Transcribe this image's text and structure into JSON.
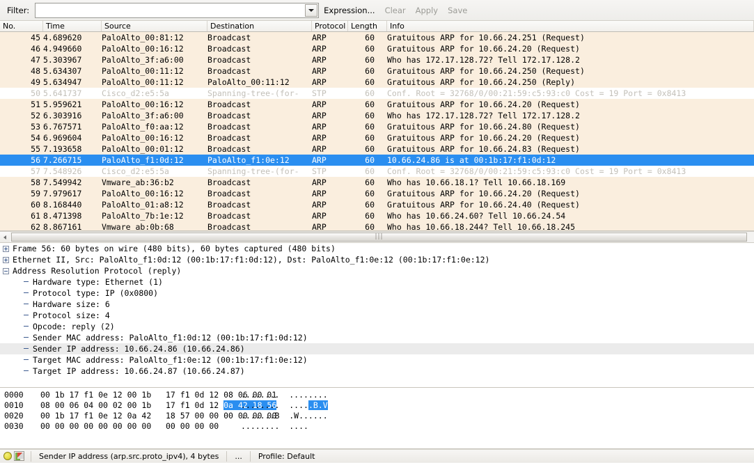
{
  "app": {
    "title": "Wireshark"
  },
  "filter_bar": {
    "label": "Filter:",
    "value": "",
    "placeholder": "",
    "dropdown_icon": "chevron-down-icon",
    "expression_label": "Expression...",
    "clear_label": "Clear",
    "apply_label": "Apply",
    "save_label": "Save",
    "accent_selected": "#2a8ef0",
    "row_bg": "#faeede",
    "stp_row_bg": "#ffffff",
    "stp_text": "#c0bdb6"
  },
  "packet_list": {
    "columns": [
      "No.",
      "Time",
      "Source",
      "Destination",
      "Protocol",
      "Length",
      "Info"
    ],
    "rows": [
      {
        "no": "45",
        "time": "4.689620",
        "source": "PaloAlto_00:81:12",
        "destination": "Broadcast",
        "protocol": "ARP",
        "length": "60",
        "info": "Gratuitous ARP for 10.66.24.251 (Request)",
        "style": "arp"
      },
      {
        "no": "46",
        "time": "4.949660",
        "source": "PaloAlto_00:16:12",
        "destination": "Broadcast",
        "protocol": "ARP",
        "length": "60",
        "info": "Gratuitous ARP for 10.66.24.20 (Request)",
        "style": "arp"
      },
      {
        "no": "47",
        "time": "5.303967",
        "source": "PaloAlto_3f:a6:00",
        "destination": "Broadcast",
        "protocol": "ARP",
        "length": "60",
        "info": "Who has 172.17.128.72?  Tell 172.17.128.2",
        "style": "arp"
      },
      {
        "no": "48",
        "time": "5.634307",
        "source": "PaloAlto_00:11:12",
        "destination": "Broadcast",
        "protocol": "ARP",
        "length": "60",
        "info": "Gratuitous ARP for 10.66.24.250 (Request)",
        "style": "arp"
      },
      {
        "no": "49",
        "time": "5.634947",
        "source": "PaloAlto_00:11:12",
        "destination": "PaloAlto_00:11:12",
        "protocol": "ARP",
        "length": "60",
        "info": "Gratuitous ARP for 10.66.24.250 (Reply)",
        "style": "arp"
      },
      {
        "no": "50",
        "time": "5.641737",
        "source": "Cisco_d2:e5:5a",
        "destination": "Spanning-tree-(for-",
        "protocol": "STP",
        "length": "60",
        "info": "Conf. Root = 32768/0/00:21:59:c5:93:c0  Cost = 19  Port = 0x8413",
        "style": "stp"
      },
      {
        "no": "51",
        "time": "5.959621",
        "source": "PaloAlto_00:16:12",
        "destination": "Broadcast",
        "protocol": "ARP",
        "length": "60",
        "info": "Gratuitous ARP for 10.66.24.20 (Request)",
        "style": "arp"
      },
      {
        "no": "52",
        "time": "6.303916",
        "source": "PaloAlto_3f:a6:00",
        "destination": "Broadcast",
        "protocol": "ARP",
        "length": "60",
        "info": "Who has 172.17.128.72?  Tell 172.17.128.2",
        "style": "arp"
      },
      {
        "no": "53",
        "time": "6.767571",
        "source": "PaloAlto_f0:aa:12",
        "destination": "Broadcast",
        "protocol": "ARP",
        "length": "60",
        "info": "Gratuitous ARP for 10.66.24.80 (Request)",
        "style": "arp"
      },
      {
        "no": "54",
        "time": "6.969604",
        "source": "PaloAlto_00:16:12",
        "destination": "Broadcast",
        "protocol": "ARP",
        "length": "60",
        "info": "Gratuitous ARP for 10.66.24.20 (Request)",
        "style": "arp"
      },
      {
        "no": "55",
        "time": "7.193658",
        "source": "PaloAlto_00:01:12",
        "destination": "Broadcast",
        "protocol": "ARP",
        "length": "60",
        "info": "Gratuitous ARP for 10.66.24.83 (Request)",
        "style": "arp"
      },
      {
        "no": "56",
        "time": "7.266715",
        "source": "PaloAlto_f1:0d:12",
        "destination": "PaloAlto_f1:0e:12",
        "protocol": "ARP",
        "length": "60",
        "info": "10.66.24.86 is at 00:1b:17:f1:0d:12",
        "style": "selected"
      },
      {
        "no": "57",
        "time": "7.548926",
        "source": "Cisco_d2:e5:5a",
        "destination": "Spanning-tree-(for-",
        "protocol": "STP",
        "length": "60",
        "info": "Conf. Root = 32768/0/00:21:59:c5:93:c0  Cost = 19  Port = 0x8413",
        "style": "stp"
      },
      {
        "no": "58",
        "time": "7.549942",
        "source": "Vmware_ab:36:b2",
        "destination": "Broadcast",
        "protocol": "ARP",
        "length": "60",
        "info": "Who has 10.66.18.1?  Tell 10.66.18.169",
        "style": "arp"
      },
      {
        "no": "59",
        "time": "7.979617",
        "source": "PaloAlto_00:16:12",
        "destination": "Broadcast",
        "protocol": "ARP",
        "length": "60",
        "info": "Gratuitous ARP for 10.66.24.20 (Request)",
        "style": "arp"
      },
      {
        "no": "60",
        "time": "8.168440",
        "source": "PaloAlto_01:a8:12",
        "destination": "Broadcast",
        "protocol": "ARP",
        "length": "60",
        "info": "Gratuitous ARP for 10.66.24.40 (Request)",
        "style": "arp"
      },
      {
        "no": "61",
        "time": "8.471398",
        "source": "PaloAlto_7b:1e:12",
        "destination": "Broadcast",
        "protocol": "ARP",
        "length": "60",
        "info": "Who has 10.66.24.60?  Tell 10.66.24.54",
        "style": "arp"
      },
      {
        "no": "62",
        "time": "8.867161",
        "source": "Vmware_ab:0b:68",
        "destination": "Broadcast",
        "protocol": "ARP",
        "length": "60",
        "info": "Who has 10.66.18.244?  Tell 10.66.18.245",
        "style": "arp"
      }
    ]
  },
  "detail_tree": {
    "nodes": [
      {
        "twisty": "plus",
        "indent": 0,
        "text": "Frame 56: 60 bytes on wire (480 bits), 60 bytes captured (480 bits)",
        "selected": false
      },
      {
        "twisty": "plus",
        "indent": 0,
        "text": "Ethernet II, Src: PaloAlto_f1:0d:12 (00:1b:17:f1:0d:12), Dst: PaloAlto_f1:0e:12 (00:1b:17:f1:0e:12)",
        "selected": false
      },
      {
        "twisty": "minus",
        "indent": 0,
        "text": "Address Resolution Protocol (reply)",
        "selected": false
      },
      {
        "twisty": "none",
        "indent": 1,
        "text": "Hardware type: Ethernet (1)",
        "selected": false
      },
      {
        "twisty": "none",
        "indent": 1,
        "text": "Protocol type: IP (0x0800)",
        "selected": false
      },
      {
        "twisty": "none",
        "indent": 1,
        "text": "Hardware size: 6",
        "selected": false
      },
      {
        "twisty": "none",
        "indent": 1,
        "text": "Protocol size: 4",
        "selected": false
      },
      {
        "twisty": "none",
        "indent": 1,
        "text": "Opcode: reply (2)",
        "selected": false
      },
      {
        "twisty": "none",
        "indent": 1,
        "text": "Sender MAC address: PaloAlto_f1:0d:12 (00:1b:17:f1:0d:12)",
        "selected": false
      },
      {
        "twisty": "none",
        "indent": 1,
        "text": "Sender IP address: 10.66.24.86 (10.66.24.86)",
        "selected": true
      },
      {
        "twisty": "none",
        "indent": 1,
        "text": "Target MAC address: PaloAlto_f1:0e:12 (00:1b:17:f1:0e:12)",
        "selected": false
      },
      {
        "twisty": "none",
        "indent": 1,
        "text": "Target IP address: 10.66.24.87 (10.66.24.87)",
        "selected": false
      }
    ]
  },
  "hex_pane": {
    "rows": [
      {
        "offset": "0000",
        "bytes_pre": "00 1b 17 f1 0e 12 00 1b   17 f1 0d 12 08 06 00 01",
        "bytes_hl": "",
        "bytes_post": "",
        "ascii_pre": "........  ........",
        "ascii_hl": "",
        "ascii_post": ""
      },
      {
        "offset": "0010",
        "bytes_pre": "08 00 06 04 00 02 00 1b   17 f1 0d 12 ",
        "bytes_hl": "0a 42 18 56",
        "bytes_post": "",
        "ascii_pre": "........  ....",
        "ascii_hl": ".B.V",
        "ascii_post": ""
      },
      {
        "offset": "0020",
        "bytes_pre": "00 1b 17 f1 0e 12 0a 42   18 57 00 00 00 00 00 00",
        "bytes_hl": "",
        "bytes_post": "",
        "ascii_pre": ".......B  .W......",
        "ascii_hl": "",
        "ascii_post": ""
      },
      {
        "offset": "0030",
        "bytes_pre": "00 00 00 00 00 00 00 00   00 00 00 00",
        "bytes_hl": "",
        "bytes_post": "",
        "ascii_pre": "........  ....",
        "ascii_hl": "",
        "ascii_post": ""
      }
    ]
  },
  "status_bar": {
    "ready_icon": "yellow-circle-icon",
    "capture_icon": "capture-file-icon",
    "field_text": "Sender IP address (arp.src.proto_ipv4), 4 bytes",
    "packets_text": "...",
    "profile_text": "Profile: Default"
  }
}
